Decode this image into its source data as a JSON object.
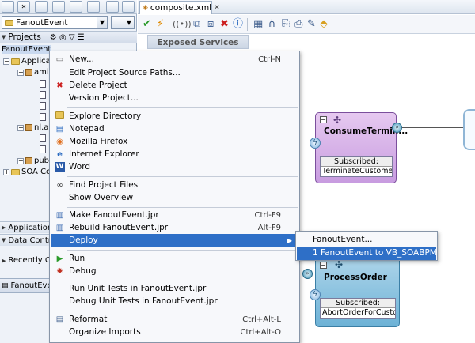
{
  "left_panel": {
    "app_selector": {
      "value": "FanoutEvent"
    },
    "projects_label": "Projects",
    "tree": [
      {
        "label": "FanoutEvent"
      },
      {
        "label": "Applicati"
      },
      {
        "label": "ami"
      },
      {
        "label": "nl.a"
      },
      {
        "label": "pub"
      },
      {
        "label": "SOA Co"
      }
    ],
    "sections": [
      {
        "label": "Application R"
      },
      {
        "label": "Data Controls"
      },
      {
        "label": "Recently Ope"
      }
    ],
    "structure_tab": "FanoutEvent"
  },
  "editor": {
    "tab_label": "composite.xml",
    "exposed_services": "Exposed Services"
  },
  "context_menu": {
    "items": [
      {
        "label": "New...",
        "accel": "Ctrl-N",
        "icon": "new-icon"
      },
      {
        "label": "Edit Project Source Paths...",
        "accel": "",
        "icon": ""
      },
      {
        "label": "Delete Project",
        "accel": "",
        "icon": "delete-icon"
      },
      {
        "label": "Version Project...",
        "accel": "",
        "icon": ""
      },
      {
        "label": "Explore Directory",
        "accel": "",
        "icon": "folder-icon"
      },
      {
        "label": "Notepad",
        "accel": "",
        "icon": "notepad-icon"
      },
      {
        "label": "Mozilla Firefox",
        "accel": "",
        "icon": "firefox-icon"
      },
      {
        "label": "Internet Explorer",
        "accel": "",
        "icon": "ie-icon"
      },
      {
        "label": "Word",
        "accel": "",
        "icon": "word-icon"
      },
      {
        "label": "Find Project Files",
        "accel": "",
        "icon": "binoculars-icon"
      },
      {
        "label": "Show Overview",
        "accel": "",
        "icon": ""
      },
      {
        "label": "Make FanoutEvent.jpr",
        "accel": "Ctrl-F9",
        "icon": "make-icon"
      },
      {
        "label": "Rebuild FanoutEvent.jpr",
        "accel": "Alt-F9",
        "icon": "rebuild-icon"
      },
      {
        "label": "Deploy",
        "accel": "",
        "icon": ""
      },
      {
        "label": "Run",
        "accel": "",
        "icon": "run-icon"
      },
      {
        "label": "Debug",
        "accel": "",
        "icon": "debug-icon"
      },
      {
        "label": "Run Unit Tests in FanoutEvent.jpr",
        "accel": "",
        "icon": ""
      },
      {
        "label": "Debug Unit Tests in FanoutEvent.jpr",
        "accel": "",
        "icon": ""
      },
      {
        "label": "Reformat",
        "accel": "Ctrl+Alt-L",
        "icon": "reformat-icon"
      },
      {
        "label": "Organize Imports",
        "accel": "Ctrl+Alt-O",
        "icon": ""
      }
    ]
  },
  "deploy_submenu": {
    "items": [
      {
        "label": "FanoutEvent..."
      },
      {
        "label": "1  FanoutEvent to VB_SOABPM"
      }
    ]
  },
  "components": {
    "consume": {
      "title": "ConsumeTermin...",
      "subscribed_label": "Subscribed:",
      "subscribed_value": "TerminateCustomer"
    },
    "process": {
      "title": "ProcessOrder",
      "subscribed_label": "Subscribed:",
      "subscribed_value": "AbortOrderForCustomer"
    }
  },
  "colors": {
    "highlight": "#2e6fc7",
    "mediator_purple": "#c89ce0",
    "bpel_blue": "#6db2d6"
  }
}
